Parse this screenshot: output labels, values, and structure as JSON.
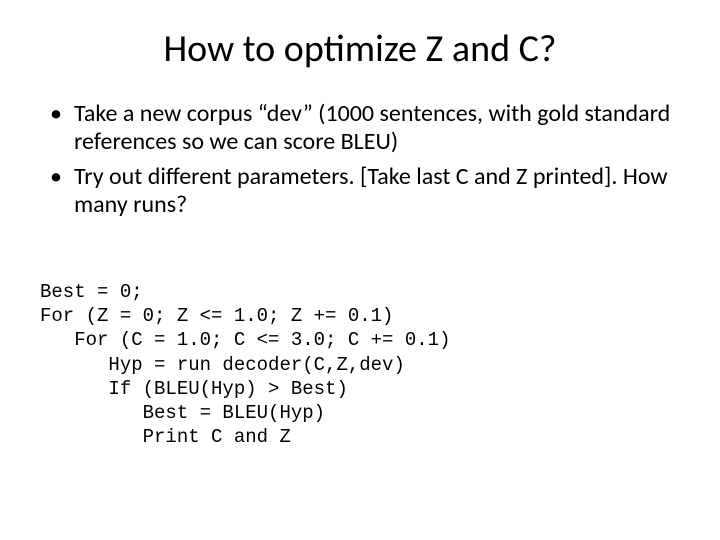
{
  "title": "How to optimize Z and C?",
  "bullets": [
    "Take a new corpus “dev” (1000 sentences, with gold standard references so we can score BLEU)",
    "Try out different parameters. [Take last C and Z printed]. How many runs?"
  ],
  "code": {
    "l1": "Best = 0;",
    "l2": "For (Z = 0; Z <= 1.0; Z += 0.1)",
    "l3": "   For (C = 1.0; C <= 3.0; C += 0.1)",
    "l4": "      Hyp = run decoder(C,Z,dev)",
    "l5": "      If (BLEU(Hyp) > Best)",
    "l6": "         Best = BLEU(Hyp)",
    "l7": "         Print C and Z"
  }
}
